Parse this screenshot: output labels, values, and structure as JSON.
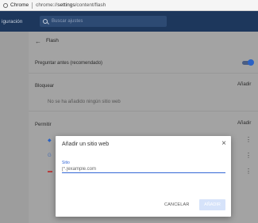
{
  "omnibox": {
    "site_label": "Chrome",
    "url_prefix": "chrome://",
    "url_host": "settings",
    "url_path": "/content/flash"
  },
  "header": {
    "title": "iguración",
    "search_placeholder": "Buscar ajustes"
  },
  "page": {
    "title": "Flash",
    "ask_first_label": "Preguntar antes (recomendado)",
    "block_heading": "Bloquear",
    "block_add": "Añadir",
    "block_empty": "No se ha añadido ningún sitio web",
    "allow_heading": "Permitir",
    "allow_add": "Añadir"
  },
  "dialog": {
    "title": "Añadir un sitio web",
    "field_label": "Sitio",
    "field_value": "[*.]example.com",
    "cancel_label": "CANCELAR",
    "add_label": "AÑADIR"
  },
  "colors": {
    "header_bg": "#1d375c",
    "accent": "#3367d6",
    "toggle_on": "#2b62c4"
  }
}
